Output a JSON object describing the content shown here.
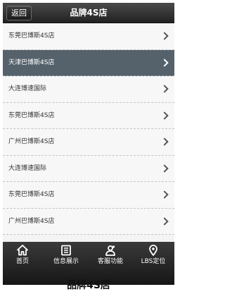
{
  "header": {
    "back_label": "返回",
    "title": "品牌4S店"
  },
  "list": {
    "items": [
      {
        "label": "东莞巴博斯4S店",
        "active": false
      },
      {
        "label": "天津巴博斯4S店",
        "active": true
      },
      {
        "label": "大连博速国际",
        "active": false
      },
      {
        "label": "东莞巴博斯4S店",
        "active": false
      },
      {
        "label": "广州巴博斯4S店",
        "active": false
      },
      {
        "label": "大连博速国际",
        "active": false
      },
      {
        "label": "东莞巴博斯4S店",
        "active": false
      },
      {
        "label": "广州巴博斯4S店",
        "active": false
      }
    ]
  },
  "tabbar": {
    "tabs": [
      {
        "label": "首页",
        "icon": "home-icon"
      },
      {
        "label": "信息展示",
        "icon": "info-icon"
      },
      {
        "label": "客服功能",
        "icon": "service-icon"
      },
      {
        "label": "LBS定位",
        "icon": "location-pin-icon"
      }
    ]
  },
  "caption": "品牌4S店"
}
